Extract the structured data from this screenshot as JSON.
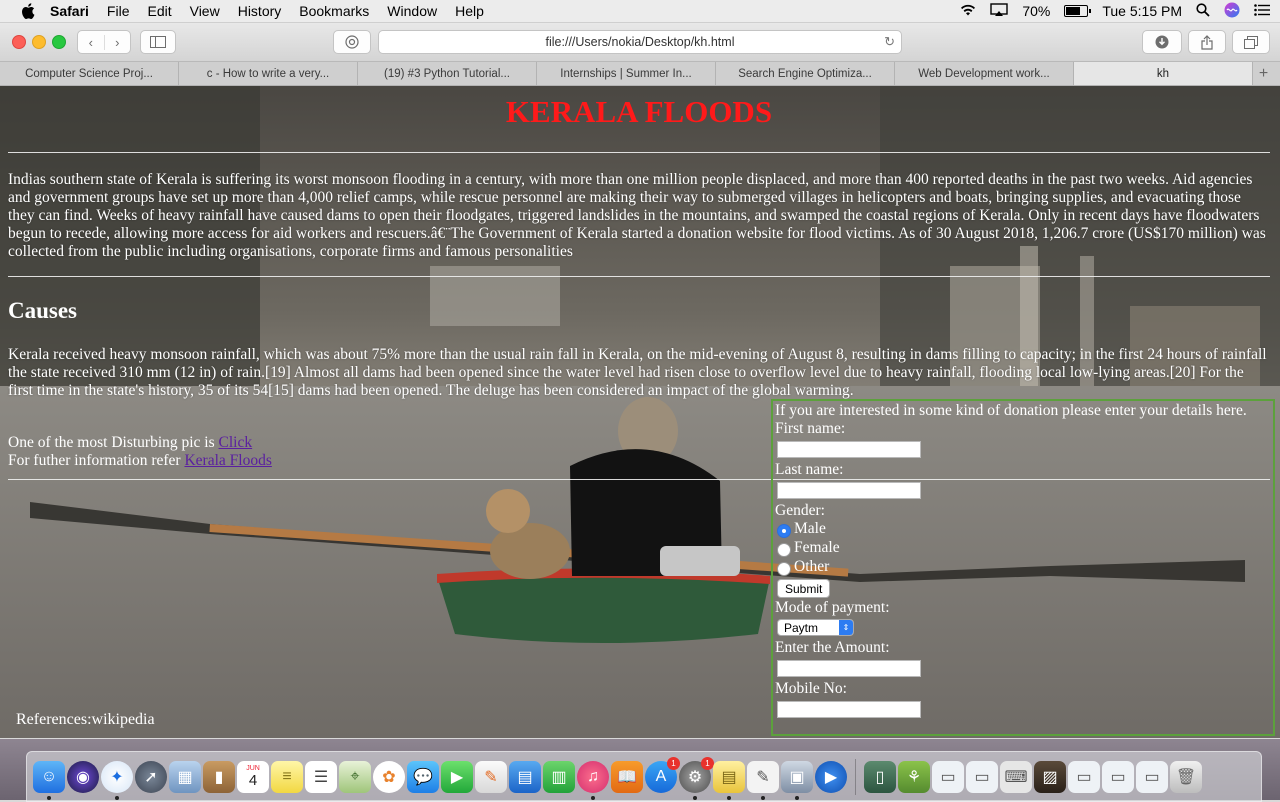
{
  "menubar": {
    "app": "Safari",
    "items": [
      "File",
      "Edit",
      "View",
      "History",
      "Bookmarks",
      "Window",
      "Help"
    ],
    "battery": "70%",
    "battery_level": 0.7,
    "clock": "Tue 5:15 PM"
  },
  "browser": {
    "url": "file:///Users/nokia/Desktop/kh.html",
    "tabs": [
      "Computer Science Proj...",
      "c - How to write a very...",
      "(19) #3 Python Tutorial...",
      "Internships | Summer In...",
      "Search Engine Optimiza...",
      "Web Development work...",
      "kh"
    ]
  },
  "page": {
    "title": "KERALA FLOODS",
    "intro": "Indias southern state of Kerala is suffering its worst monsoon flooding in a century, with more than one million people displaced, and more than 400 reported deaths in the past two weeks. Aid agencies and government groups have set up more than 4,000 relief camps, while rescue personnel are making their way to submerged villages in helicopters and boats, bringing supplies, and evacuating those they can find. Weeks of heavy rainfall have caused dams to open their floodgates, triggered landslides in the mountains, and swamped the coastal regions of Kerala. Only in recent days have floodwaters begun to recede, allowing more access for aid workers and rescuers.â€¨The Government of Kerala started a donation website for flood victims. As of 30 August 2018, 1,206.7 crore (US$170 million) was collected from the public including organisations, corporate firms and famous personalities",
    "causes_heading": "Causes",
    "causes_text": "Kerala received heavy monsoon rainfall, which was about 75% more than the usual rain fall in Kerala, on the mid-evening of August 8, resulting in dams filling to capacity; in the first 24 hours of rainfall the state received 310 mm (12 in) of rain.[19] Almost all dams had been opened since the water level had risen close to overflow level due to heavy rainfall, flooding local low-lying areas.[20] For the first time in the state's history, 35 of its 54[15] dams had been opened. The deluge has been considered an impact of the global warming.",
    "pic_prefix": "One of the most Disturbing pic is ",
    "pic_link": "Click",
    "info_prefix": "For futher information refer ",
    "info_link": "Kerala Floods",
    "references": "References:wikipedia"
  },
  "form": {
    "intro": "If you are interested in some kind of donation please enter your details here.",
    "first_name_label": "First name:",
    "first_name_value": "",
    "last_name_label": "Last name:",
    "last_name_value": "",
    "gender_label": "Gender:",
    "gender_options": [
      "Male",
      "Female",
      "Other"
    ],
    "gender_selected": "Male",
    "submit_label": "Submit",
    "payment_label": "Mode of payment:",
    "payment_selected": "Paytm",
    "amount_label": "Enter the Amount:",
    "amount_value": "",
    "mobile_label": "Mobile No:",
    "mobile_value": ""
  },
  "dock": {
    "calendar_month": "JUN",
    "calendar_day": "4",
    "badges": {
      "appstore": "1",
      "preferences": "1"
    }
  },
  "colors": {
    "title": "#ff1a1a",
    "link": "#5a1fa0",
    "form_border": "#5ca13c"
  }
}
